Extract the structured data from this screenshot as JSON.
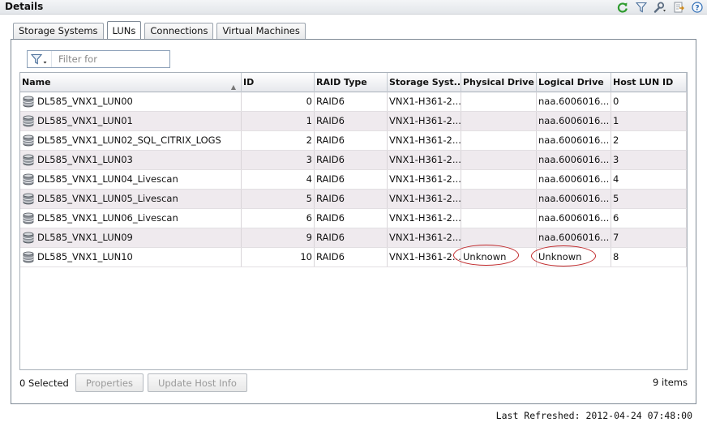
{
  "header": {
    "title": "Details"
  },
  "tabs": [
    {
      "label": "Storage Systems",
      "active": false
    },
    {
      "label": "LUNs",
      "active": true
    },
    {
      "label": "Connections",
      "active": false
    },
    {
      "label": "Virtual Machines",
      "active": false
    }
  ],
  "filter": {
    "placeholder": "Filter for",
    "value": ""
  },
  "table": {
    "columns": [
      "Name",
      "ID",
      "RAID Type",
      "Storage Syst...",
      "Physical Drive",
      "Logical Drive",
      "Host LUN ID"
    ],
    "sort": {
      "column": "Name",
      "direction": "ascending"
    },
    "rows": [
      {
        "name": "DL585_VNX1_LUN00",
        "id": "0",
        "raid": "RAID6",
        "storage": "VNX1-H361-2...",
        "physical": "",
        "logical": "naa.6006016...",
        "host_lun": "0"
      },
      {
        "name": "DL585_VNX1_LUN01",
        "id": "1",
        "raid": "RAID6",
        "storage": "VNX1-H361-2...",
        "physical": "",
        "logical": "naa.6006016...",
        "host_lun": "1"
      },
      {
        "name": "DL585_VNX1_LUN02_SQL_CITRIX_LOGS",
        "id": "2",
        "raid": "RAID6",
        "storage": "VNX1-H361-2...",
        "physical": "",
        "logical": "naa.6006016...",
        "host_lun": "2"
      },
      {
        "name": "DL585_VNX1_LUN03",
        "id": "3",
        "raid": "RAID6",
        "storage": "VNX1-H361-2...",
        "physical": "",
        "logical": "naa.6006016...",
        "host_lun": "3"
      },
      {
        "name": "DL585_VNX1_LUN04_Livescan",
        "id": "4",
        "raid": "RAID6",
        "storage": "VNX1-H361-2...",
        "physical": "",
        "logical": "naa.6006016...",
        "host_lun": "4"
      },
      {
        "name": "DL585_VNX1_LUN05_Livescan",
        "id": "5",
        "raid": "RAID6",
        "storage": "VNX1-H361-2...",
        "physical": "",
        "logical": "naa.6006016...",
        "host_lun": "5"
      },
      {
        "name": "DL585_VNX1_LUN06_Livescan",
        "id": "6",
        "raid": "RAID6",
        "storage": "VNX1-H361-2...",
        "physical": "",
        "logical": "naa.6006016...",
        "host_lun": "6"
      },
      {
        "name": "DL585_VNX1_LUN09",
        "id": "9",
        "raid": "RAID6",
        "storage": "VNX1-H361-2...",
        "physical": "",
        "logical": "naa.6006016...",
        "host_lun": "7"
      },
      {
        "name": "DL585_VNX1_LUN10",
        "id": "10",
        "raid": "RAID6",
        "storage": "VNX1-H361-2...",
        "physical": "Unknown",
        "logical": "Unknown",
        "host_lun": "8"
      }
    ]
  },
  "footer": {
    "selected": "0 Selected",
    "properties_label": "Properties",
    "update_label": "Update Host Info",
    "items": "9 items"
  },
  "status": {
    "last_refreshed": "Last Refreshed: 2012-04-24 07:48:00"
  },
  "toolbar_icons": [
    "refresh-icon",
    "filter-icon",
    "wrench-icon",
    "export-icon",
    "help-icon"
  ],
  "colors": {
    "annotation_oval": "#c0282a",
    "refresh": "#2e9b2e",
    "help": "#2f6db5"
  }
}
